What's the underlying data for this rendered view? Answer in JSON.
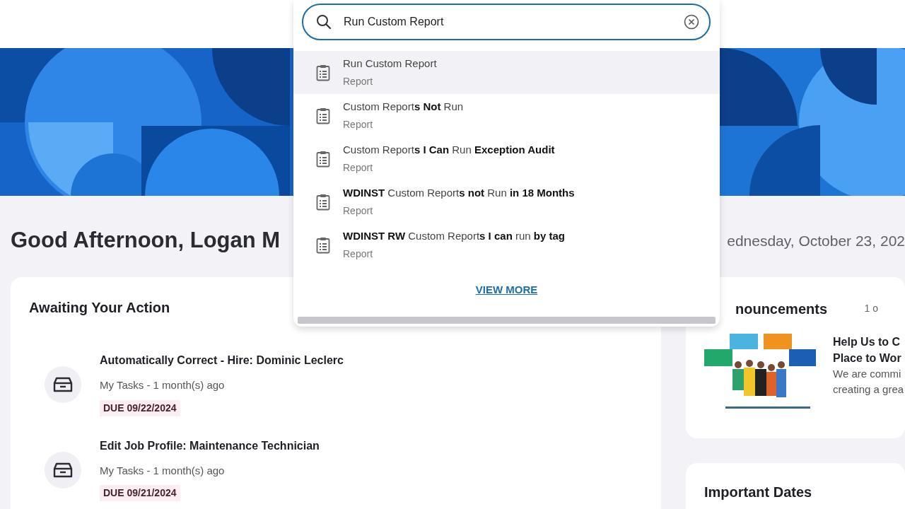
{
  "search": {
    "value": "Run Custom Report"
  },
  "suggestions": [
    {
      "title": "Run Custom Report",
      "type": "Report",
      "selected": true
    },
    {
      "title": "Custom Report**s** **Not** Run",
      "type": "Report",
      "selected": false
    },
    {
      "title": "Custom Report**s** **I Can** Run **Exception Audit**",
      "type": "Report",
      "selected": false
    },
    {
      "title": "**WDINST** Custom Report**s** **not** Run **in 18 Months**",
      "type": "Report",
      "selected": false
    },
    {
      "title": "**WDINST RW** Custom Report**s** **I can** run **by tag**",
      "type": "Report",
      "selected": false
    }
  ],
  "view_more": "VIEW MORE",
  "greeting": "Good Afternoon, Logan M",
  "date": "ednesday, October 23, 202",
  "awaiting": {
    "title": "Awaiting Your Action",
    "tasks": [
      {
        "title": "Automatically Correct - Hire: Dominic Leclerc",
        "meta": "My Tasks - 1 month(s) ago",
        "due": "DUE 09/22/2024"
      },
      {
        "title": "Edit Job Profile: Maintenance Technician",
        "meta": "My Tasks - 1 month(s) ago",
        "due": "DUE 09/21/2024"
      }
    ]
  },
  "announcements": {
    "title": "nouncements",
    "counter": "1 o",
    "items": [
      {
        "kind": "picture",
        "title_lines": [
          "Help Us to C",
          "Place to Wor"
        ],
        "body_lines": [
          "We are commi",
          "creating a grea"
        ]
      }
    ]
  },
  "important_dates": {
    "title": "Important Dates"
  }
}
